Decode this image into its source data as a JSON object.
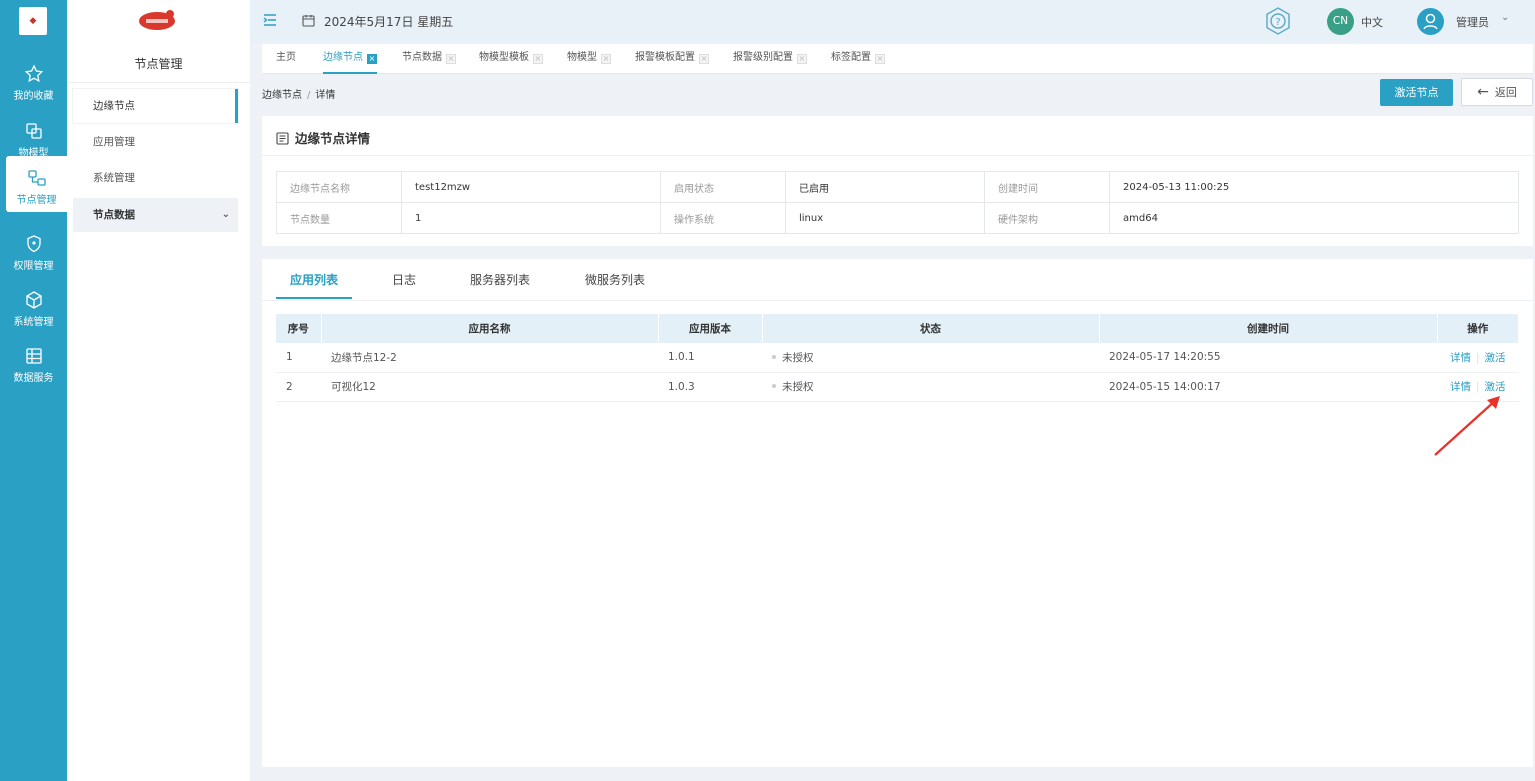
{
  "rail": {
    "items": [
      {
        "label": "我的收藏",
        "icon": "star-icon"
      },
      {
        "label": "物模型",
        "icon": "model-icon"
      },
      {
        "label": "节点管理",
        "icon": "node-icon"
      },
      {
        "label": "权限管理",
        "icon": "shield-icon"
      },
      {
        "label": "系统管理",
        "icon": "cube-icon"
      },
      {
        "label": "数据服务",
        "icon": "data-icon"
      }
    ],
    "active_index": 2,
    "accent_color": "#2aa0c4"
  },
  "sidebar": {
    "title": "节点管理",
    "items": [
      {
        "label": "边缘节点"
      },
      {
        "label": "应用管理"
      },
      {
        "label": "系统管理"
      },
      {
        "label": "节点数据"
      }
    ]
  },
  "header": {
    "date": "2024年5月17日 星期五",
    "lang_badge": "CN",
    "lang_label": "中文",
    "user_name": "管理员"
  },
  "tabs": [
    {
      "label": "主页"
    },
    {
      "label": "边缘节点"
    },
    {
      "label": "节点数据"
    },
    {
      "label": "物模型模板"
    },
    {
      "label": "物模型"
    },
    {
      "label": "报警模板配置"
    },
    {
      "label": "报警级别配置"
    },
    {
      "label": "标签配置"
    }
  ],
  "breadcrumb": {
    "parent": "边缘节点",
    "sep": "/",
    "current": "详情"
  },
  "actions": {
    "activate_node": "激活节点",
    "back": "返回"
  },
  "detail": {
    "title": "边缘节点详情",
    "rows": [
      [
        {
          "label": "边缘节点名称",
          "value": "test12mzw"
        },
        {
          "label": "启用状态",
          "value": "已启用"
        },
        {
          "label": "创建时间",
          "value": "2024-05-13 11:00:25"
        }
      ],
      [
        {
          "label": "节点数量",
          "value": "1"
        },
        {
          "label": "操作系统",
          "value": "linux"
        },
        {
          "label": "硬件架构",
          "value": "amd64"
        }
      ]
    ]
  },
  "list_tabs": [
    {
      "label": "应用列表"
    },
    {
      "label": "日志"
    },
    {
      "label": "服务器列表"
    },
    {
      "label": "微服务列表"
    }
  ],
  "app_table": {
    "columns": [
      "序号",
      "应用名称",
      "应用版本",
      "状态",
      "创建时间",
      "操作"
    ],
    "rows": [
      {
        "index": "1",
        "name": "边缘节点12-2",
        "version": "1.0.1",
        "status": "未授权",
        "created": "2024-05-17 14:20:55",
        "op_detail": "详情",
        "op_activate": "激活"
      },
      {
        "index": "2",
        "name": "可视化12",
        "version": "1.0.3",
        "status": "未授权",
        "created": "2024-05-15 14:00:17",
        "op_detail": "详情",
        "op_activate": "激活"
      }
    ]
  }
}
